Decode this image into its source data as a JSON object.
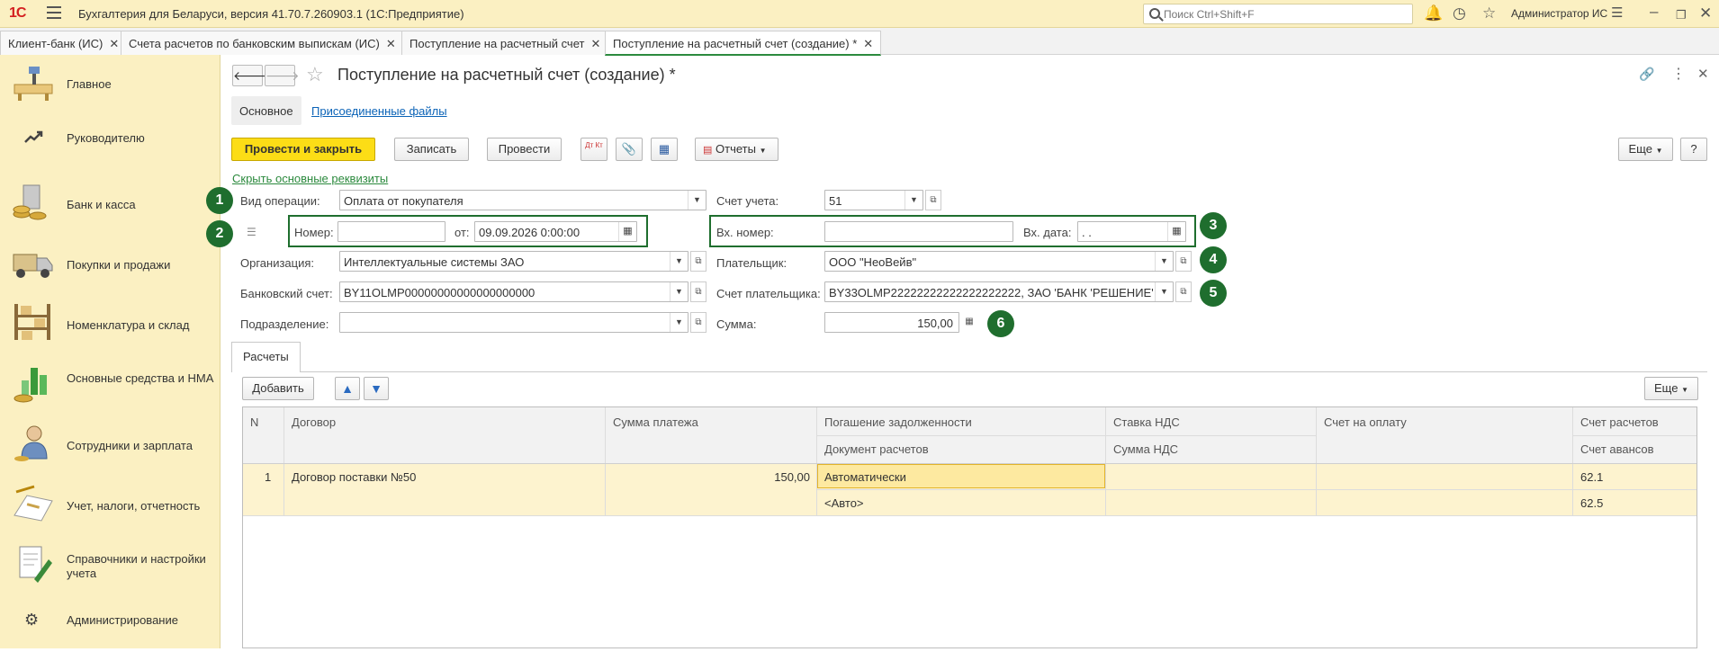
{
  "app": {
    "logo": "1С",
    "title": "Бухгалтерия для Беларуси, версия 41.70.7.260903.1  (1С:Предприятие)",
    "search_placeholder": "Поиск Ctrl+Shift+F",
    "user": "Администратор ИС"
  },
  "tabs": [
    {
      "label": "Клиент-банк (ИС)"
    },
    {
      "label": "Счета расчетов по банковским выпискам (ИС)"
    },
    {
      "label": "Поступление на расчетный счет"
    },
    {
      "label": "Поступление на расчетный счет (создание) *"
    }
  ],
  "sidebar": {
    "items": [
      {
        "label": "Главное",
        "icon": "main-desk-icon"
      },
      {
        "label": "Руководителю",
        "icon": "trend-icon"
      },
      {
        "label": "Банк и касса",
        "icon": "bank-icon"
      },
      {
        "label": "Покупки и продажи",
        "icon": "truck-icon"
      },
      {
        "label": "Номенклатура и склад",
        "icon": "warehouse-icon"
      },
      {
        "label": "Основные средства и НМА",
        "icon": "fixed-assets-icon"
      },
      {
        "label": "Сотрудники и зарплата",
        "icon": "employee-icon"
      },
      {
        "label": "Учет, налоги, отчетность",
        "icon": "accounting-icon"
      },
      {
        "label": "Справочники и настройки учета",
        "icon": "reference-icon"
      },
      {
        "label": "Администрирование",
        "icon": "gear-icon"
      }
    ]
  },
  "doc": {
    "title": "Поступление на расчетный счет (создание) *",
    "subtab_main": "Основное",
    "subtab_files": "Присоединенные файлы",
    "btn_post_close": "Провести и закрыть",
    "btn_save": "Записать",
    "btn_post": "Провести",
    "btn_dtkt": "Дт Кт",
    "btn_reports": "Отчеты",
    "btn_more": "Еще",
    "btn_help": "?",
    "hide_link": "Скрыть основные реквизиты"
  },
  "form": {
    "op_type_label": "Вид операции:",
    "op_type": "Оплата от покупателя",
    "number_label": "Номер:",
    "number": "",
    "from_label": "от:",
    "date": "09.09.2026  0:00:00",
    "org_label": "Организация:",
    "org": "Интеллектуальные системы ЗАО",
    "bank_label": "Банковский счет:",
    "bank": "BY11OLMP00000000000000000000",
    "dept_label": "Подразделение:",
    "dept": "",
    "account_label": "Счет учета:",
    "account": "51",
    "in_num_label": "Вх. номер:",
    "in_num": "",
    "in_date_label": "Вх. дата:",
    "in_date": " .  .",
    "payer_label": "Плательщик:",
    "payer": "ООО \"НеоВейв\"",
    "payer_acc_label": "Счет плательщика:",
    "payer_acc": "BY33OLMP22222222222222222222, ЗАО 'БАНК 'РЕШЕНИЕ'",
    "sum_label": "Сумма:",
    "sum": "150,00"
  },
  "badges": [
    "1",
    "2",
    "3",
    "4",
    "5",
    "6"
  ],
  "section": {
    "tab": "Расчеты",
    "add": "Добавить",
    "more": "Еще"
  },
  "table": {
    "headers": {
      "n": "N",
      "contract": "Договор",
      "amount": "Сумма платежа",
      "repay": "Погашение задолженности",
      "vat_rate": "Ставка НДС",
      "invoice": "Счет на оплату",
      "settle_acc": "Счет расчетов",
      "settle_doc": "Документ расчетов",
      "vat_sum": "Сумма НДС",
      "adv_acc": "Счет авансов"
    },
    "rows": [
      {
        "n": "1",
        "contract": "Договор поставки №50",
        "amount": "150,00",
        "repay": "Автоматически",
        "settle_doc": "<Авто>",
        "settle_acc": "62.1",
        "adv_acc": "62.5"
      }
    ]
  },
  "colors": {
    "accent_yellow": "#fcdd16",
    "sidebar_bg": "#fbf0c2",
    "badge_green": "#1f6e2e",
    "selected_row": "#fdf3cf"
  }
}
